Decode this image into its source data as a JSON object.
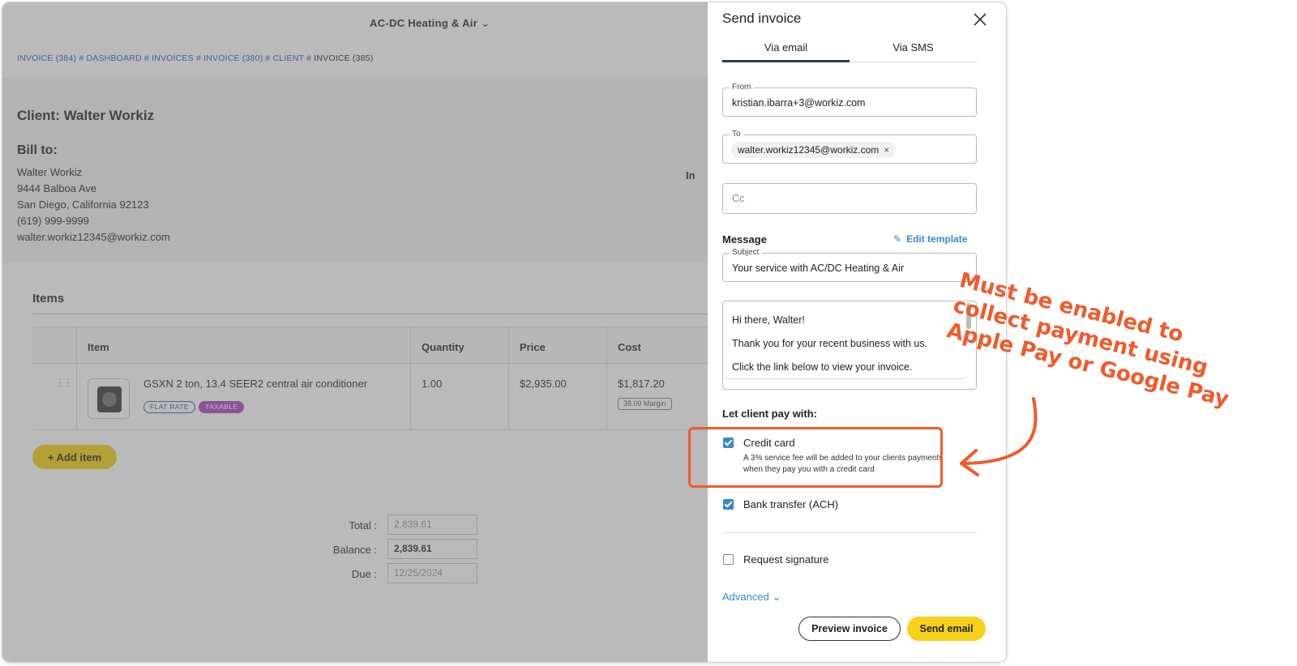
{
  "app": {
    "company": "AC-DC Heating & Air",
    "breadcrumb": {
      "trail": "INVOICE (384) # DASHBOARD # INVOICES # INVOICE (380) # CLIENT # ",
      "current": "INVOICE (385)"
    },
    "client_title": "Client: Walter Workiz",
    "bill_to": {
      "title": "Bill to:",
      "lines": [
        "Walter Workiz",
        "9444 Balboa Ave",
        "San Diego, California 92123",
        "(619) 999-9999",
        "walter.workiz12345@workiz.com"
      ]
    },
    "partial_label": "In",
    "items": {
      "title": "Items",
      "columns": [
        "Item",
        "Quantity",
        "Price",
        "Cost"
      ],
      "rows": [
        {
          "name": "GSXN 2 ton, 13.4 SEER2 central air conditioner",
          "tags": [
            "FLAT RATE",
            "TAXABLE"
          ],
          "quantity": "1.00",
          "price": "$2,935.00",
          "cost": "$1,817.20",
          "margin": "38.09 Margin"
        }
      ],
      "add_label": "+ Add item"
    },
    "totals": {
      "total_label": "Total :",
      "total_value": "2,839.61",
      "balance_label": "Balance :",
      "balance_value": "2,839.61",
      "due_label": "Due :",
      "due_value": "12/25/2024"
    }
  },
  "panel": {
    "title": "Send invoice",
    "tabs": [
      {
        "label": "Via email",
        "active": true
      },
      {
        "label": "Via SMS",
        "active": false
      }
    ],
    "from": {
      "label": "From",
      "value": "kristian.ibarra+3@workiz.com"
    },
    "to": {
      "label": "To",
      "chip": "walter.workiz12345@workiz.com",
      "chip_remove": "×"
    },
    "cc": {
      "placeholder": "Cc"
    },
    "message": {
      "label": "Message",
      "edit_template": "Edit template",
      "subject_label": "Subject",
      "subject_value": "Your service with AC/DC Heating & Air",
      "body_lines": [
        "Hi there, Walter!",
        "Thank you for your recent business with us.",
        "Click the link below to view your invoice."
      ]
    },
    "pay_with": {
      "label": "Let client pay with:",
      "credit_card": {
        "label": "Credit card",
        "checked": true,
        "description": "A 3% service fee will be added to your clients payments when they pay you with a credit card"
      },
      "ach": {
        "label": "Bank transfer (ACH)",
        "checked": true
      }
    },
    "request_signature": {
      "label": "Request signature",
      "checked": false
    },
    "advanced_label": "Advanced",
    "buttons": {
      "preview": "Preview invoice",
      "send": "Send email"
    }
  },
  "annotation": {
    "lines": [
      "Must be enabled to",
      "collect payment using",
      "Apple Pay or Google Pay"
    ],
    "color": "#f05a2c"
  },
  "colors": {
    "accent_blue": "#3a87c9",
    "send_yellow": "#f7d21b",
    "tag_purple": "#b24ec2"
  }
}
